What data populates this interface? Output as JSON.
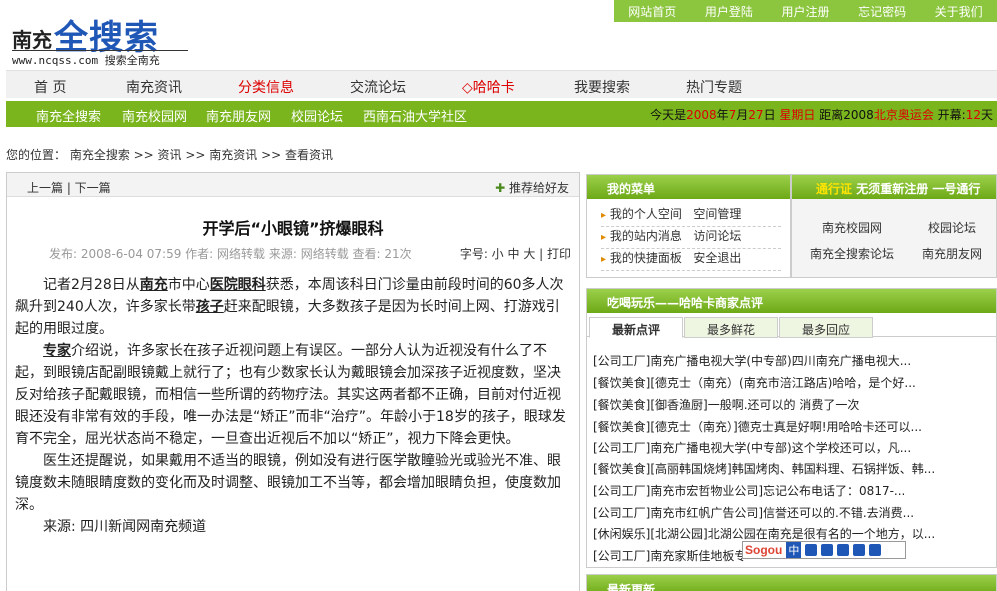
{
  "logo": {
    "city": "南充",
    "main": "全搜索",
    "url": "www.ncqss.com 搜索全南充"
  },
  "topbar": [
    "网站首页",
    "用户登陆",
    "用户注册",
    "忘记密码",
    "关于我们"
  ],
  "mainnav": [
    "首 页",
    "南充资讯",
    "分类信息",
    "交流论坛",
    "◇哈哈卡",
    "我要搜索",
    "热门专题"
  ],
  "subnav": {
    "items": [
      "南充全搜索",
      "南充校园网",
      "南充朋友网",
      "校园论坛",
      "西南石油大学社区"
    ],
    "today_prefix": "今天是",
    "year": "2008",
    "nian": "年",
    "month": "7",
    "yue": "月",
    "day": "27",
    "ri": "日",
    "weekday": "星期日",
    "distance": "距离2008",
    "event": "北京奥运会",
    "kaimu": "开幕:",
    "days": "12",
    "tian": "天"
  },
  "breadcrumb": "您的位置： 南充全搜索 >> 资讯 >> 南充资讯 >> 查看资讯",
  "article": {
    "prev_next": "上一篇 | 下一篇",
    "share": "推荐给好友",
    "title": "开学后“小眼镜”挤爆眼科",
    "meta": "发布: 2008-6-04 07:59    作者: 网络转载    来源: 网络转载    查看: 21次",
    "size_label": "字号: 小 中 大 | 打印",
    "p1_a": "记者2月28日从",
    "p1_k1": "南充",
    "p1_b": "市中心",
    "p1_k2": "医院眼科",
    "p1_c": "获悉，本周该科日门诊量由前段时间的60多人次飙升到240人次，许多家长带",
    "p1_k3": "孩子",
    "p1_d": "赶来配眼镜，大多数孩子是因为长时间上网、打游戏引起的用眼过度。",
    "p2_k": "专家",
    "p2": "介绍说，许多家长在孩子近视问题上有误区。一部分人认为近视没有什么了不起，到眼镜店配副眼镜戴上就行了；也有少数家长认为戴眼镜会加深孩子近视度数，坚决反对给孩子配戴眼镜，而相信一些所谓的药物疗法。其实这两者都不正确，目前对付近视眼还没有非常有效的手段，唯一办法是“矫正”而非“治疗”。年龄小于18岁的孩子，眼球发育不完全，屈光状态尚不稳定，一旦查出近视后不加以“矫正”，视力下降会更快。",
    "p3": "医生还提醒说，如果戴用不适当的眼镜，例如没有进行医学散瞳验光或验光不准、眼镜度数未随眼睛度数的变化而及时调整、眼镜加工不当等，都会增加眼睛负担，使度数加深。",
    "source": "来源:  四川新闻网南充频道"
  },
  "menu": {
    "title": "我的菜单",
    "rows": [
      [
        "我的个人空间",
        "空间管理"
      ],
      [
        "我的站内消息",
        "访问论坛"
      ],
      [
        "我的快捷面板",
        "安全退出"
      ]
    ]
  },
  "pass": {
    "title": "通行证",
    "subtitle": "无须重新注册 一号通行",
    "links": [
      "南充校园网",
      "校园论坛",
      "南充全搜索论坛",
      "南充朋友网"
    ]
  },
  "reviews": {
    "title": "吃喝玩乐——哈哈卡商家点评",
    "tabs": [
      "最新点评",
      "最多鲜花",
      "最多回应"
    ],
    "items": [
      "[公司工厂]南充广播电视大学(中专部)四川南充广播电视大...",
      "[餐饮美食][德克士（南充）(南充市涪江路店)哈哈，是个好...",
      "[餐饮美食][御香渔厨]一般啊.还可以的 消费了一次",
      "[餐饮美食][德克士（南充）]德克士真是好啊!用哈哈卡还可以...",
      "[公司工厂]南充广播电视大学(中专部)这个学校还可以，凡...",
      "[餐饮美食][高丽韩国烧烤]韩国烤肉、韩国料理、石锅拌饭、韩...",
      "[公司工厂]南充市宏哲物业公司]忘记公布电话了：0817-...",
      "[公司工厂]南充市红帆广告公司]信誉还可以的.不错.去消费...",
      "[休闲娱乐][北湖公园]北湖公园在南充是很有名的一个地方，以...",
      "[公司工厂]南充家斯佳地板专"
    ]
  },
  "latest": {
    "title": "最新更新"
  },
  "ime": {
    "brand": "Sogou",
    "mode": "中"
  }
}
